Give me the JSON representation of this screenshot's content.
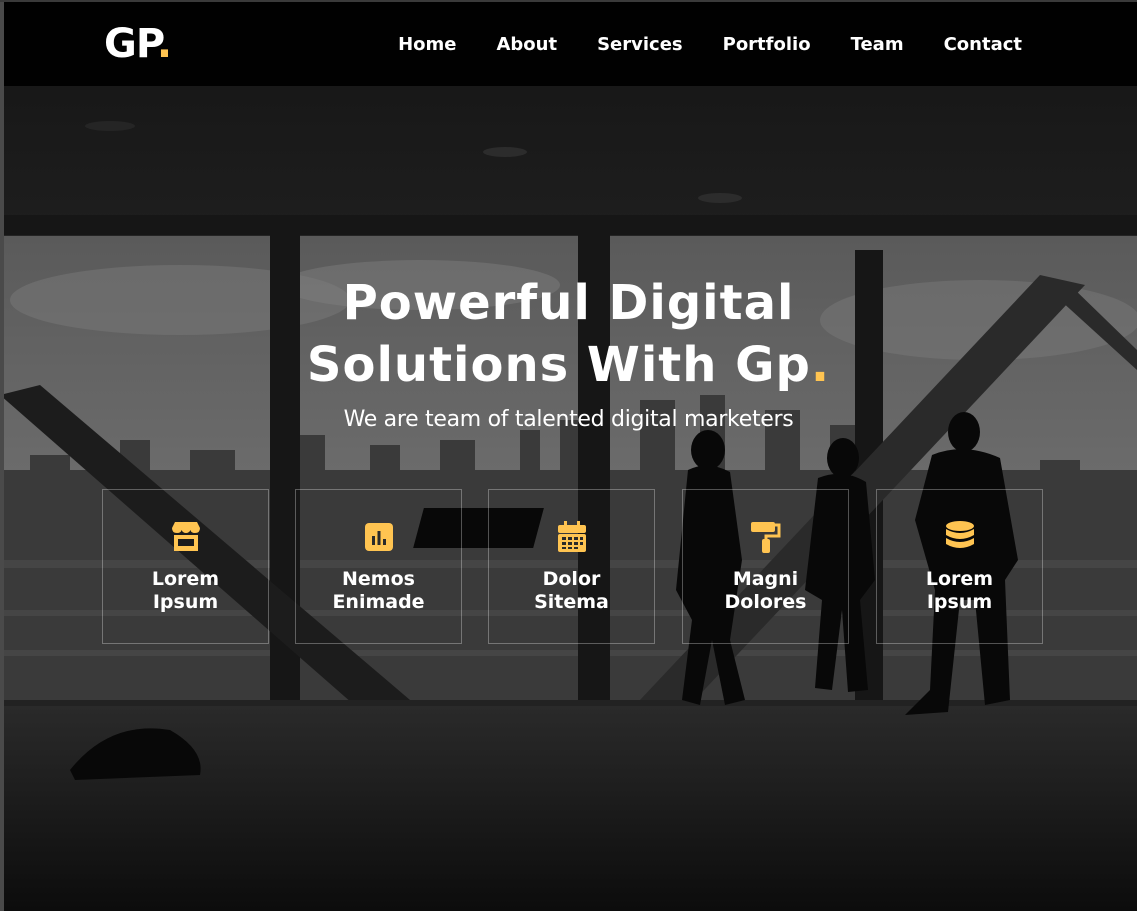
{
  "colors": {
    "accent": "#ffc451",
    "header_bg": "#000000"
  },
  "logo": {
    "text": "GP",
    "dot": "."
  },
  "nav": {
    "items": [
      {
        "label": "Home"
      },
      {
        "label": "About"
      },
      {
        "label": "Services"
      },
      {
        "label": "Portfolio"
      },
      {
        "label": "Team"
      },
      {
        "label": "Contact"
      }
    ]
  },
  "hero": {
    "title_line1": "Powerful Digital",
    "title_line2": "Solutions With Gp",
    "title_dot": ".",
    "subtitle": "We are team of talented digital marketers"
  },
  "features": [
    {
      "icon": "store-icon",
      "line1": "Lorem",
      "line2": "Ipsum"
    },
    {
      "icon": "bar-chart-icon",
      "line1": "Nemos",
      "line2": "Enimade"
    },
    {
      "icon": "calendar-icon",
      "line1": "Dolor",
      "line2": "Sitema"
    },
    {
      "icon": "paint-roller-icon",
      "line1": "Magni",
      "line2": "Dolores"
    },
    {
      "icon": "database-icon",
      "line1": "Lorem",
      "line2": "Ipsum"
    }
  ]
}
